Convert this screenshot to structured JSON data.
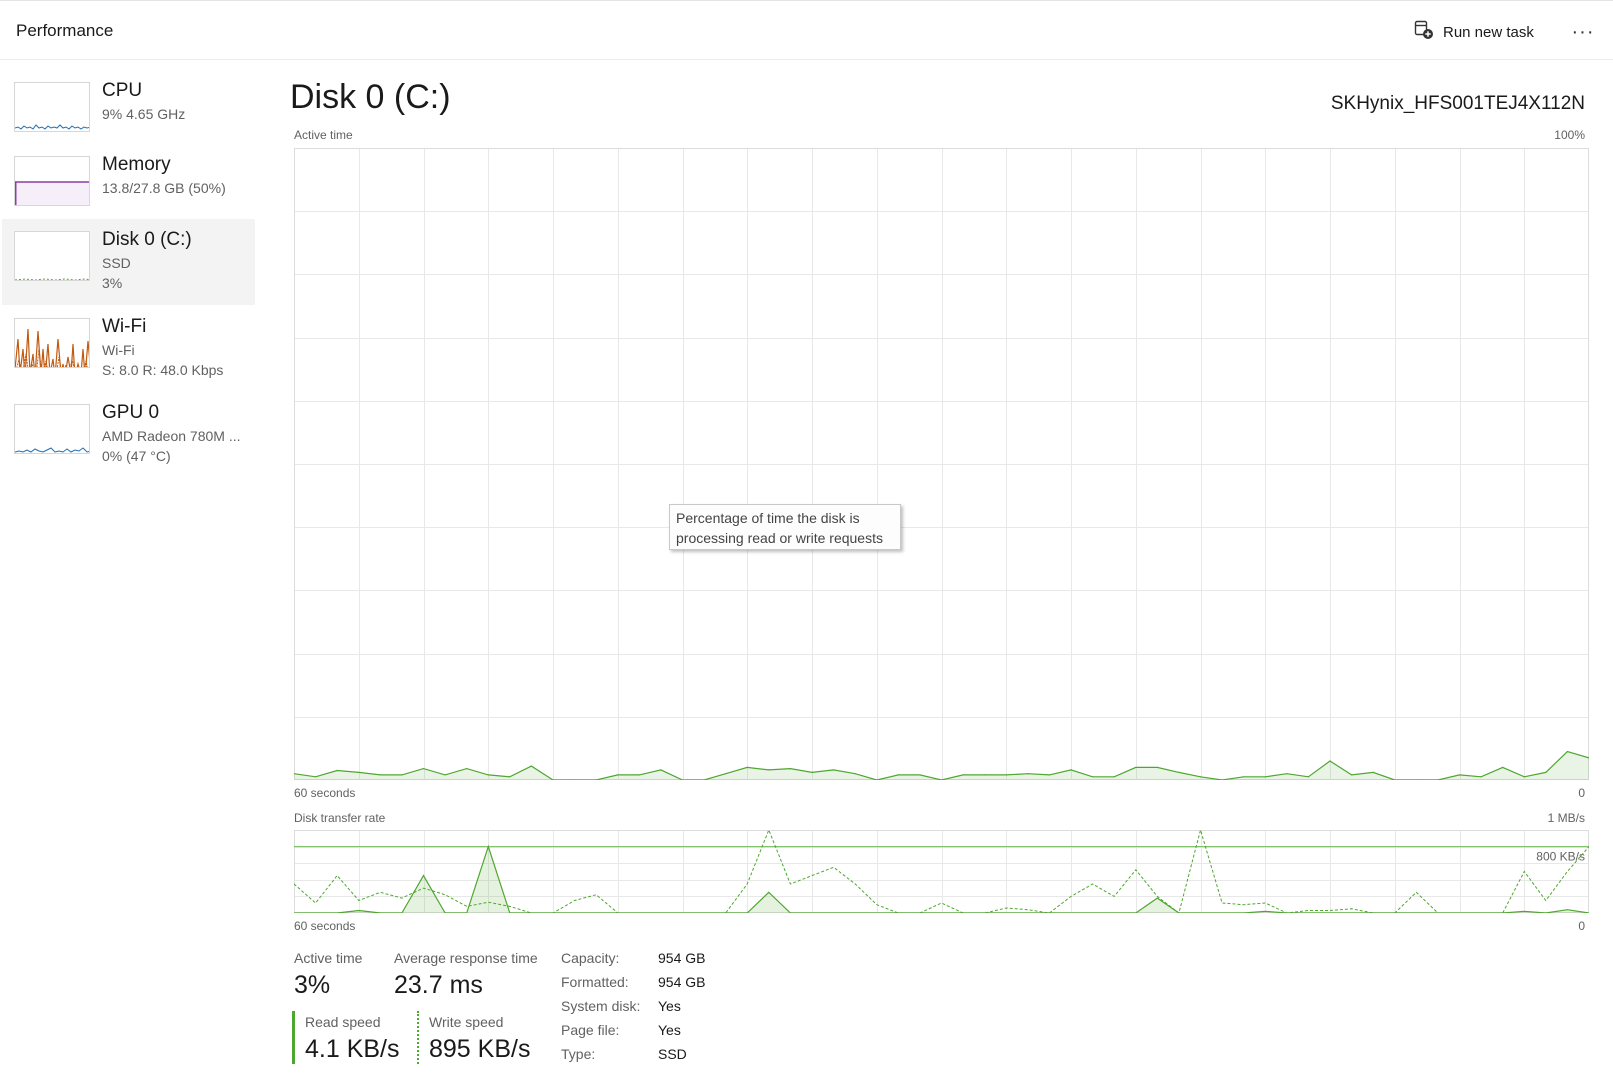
{
  "header": {
    "title": "Performance",
    "run_new_task": "Run new task",
    "more_glyph": "···"
  },
  "sidebar": {
    "items": [
      {
        "name": "CPU",
        "line1": "9%  4.65 GHz",
        "line2": "",
        "color": "#1f6fb5"
      },
      {
        "name": "Memory",
        "line1": "13.8/27.8 GB (50%)",
        "line2": "",
        "color": "#8b3fa8",
        "fill_level": 0.5
      },
      {
        "name": "Disk 0 (C:)",
        "line1": "SSD",
        "line2": "3%",
        "color": "#4ea72e",
        "selected": true
      },
      {
        "name": "Wi-Fi",
        "line1": "Wi-Fi",
        "line2": "S: 8.0  R: 48.0 Kbps",
        "color": "#c05a11"
      },
      {
        "name": "GPU 0",
        "line1": "AMD Radeon 780M ...",
        "line2": "0%  (47 °C)",
        "color": "#1f6fb5"
      }
    ]
  },
  "main": {
    "title": "Disk 0 (C:)",
    "model": "SKHynix_HFS001TEJ4X112N",
    "active_graph": {
      "label": "Active time",
      "max_label": "100%",
      "time_label": "60 seconds",
      "min_label": "0",
      "tooltip_line1": "Percentage of time the disk is",
      "tooltip_line2": "processing read or write requests",
      "color": "#4ea72e"
    },
    "transfer_graph": {
      "label": "Disk transfer rate",
      "max_label": "1 MB/s",
      "ref_label": "800 KB/s",
      "time_label": "60 seconds",
      "min_label": "0",
      "color": "#4ea72e"
    },
    "stats": {
      "active_time_label": "Active time",
      "active_time_value": "3%",
      "avg_response_label": "Average response time",
      "avg_response_value": "23.7 ms",
      "read_speed_label": "Read speed",
      "read_speed_value": "4.1 KB/s",
      "write_speed_label": "Write speed",
      "write_speed_value": "895 KB/s"
    },
    "properties": [
      {
        "key": "Capacity:",
        "value": "954 GB"
      },
      {
        "key": "Formatted:",
        "value": "954 GB"
      },
      {
        "key": "System disk:",
        "value": "Yes"
      },
      {
        "key": "Page file:",
        "value": "Yes"
      },
      {
        "key": "Type:",
        "value": "SSD"
      }
    ]
  },
  "chart_data": [
    {
      "type": "area",
      "title": "Active time",
      "xlabel": "60 seconds",
      "ylabel": "",
      "xlim": [
        60,
        0
      ],
      "ylim": [
        0,
        100
      ],
      "x": [
        60,
        59,
        58,
        57,
        56,
        55,
        54,
        53,
        52,
        51,
        50,
        49,
        48,
        47,
        46,
        45,
        44,
        43,
        42,
        41,
        40,
        39,
        38,
        37,
        36,
        35,
        34,
        33,
        32,
        31,
        30,
        29,
        28,
        27,
        26,
        25,
        24,
        23,
        22,
        21,
        20,
        19,
        18,
        17,
        16,
        15,
        14,
        13,
        12,
        11,
        10,
        9,
        8,
        7,
        6,
        5,
        4,
        3,
        2,
        1,
        0
      ],
      "series": [
        {
          "values": [
            1,
            0.5,
            1.5,
            1.2,
            0.8,
            0.8,
            1.8,
            0.8,
            1.8,
            0.8,
            0.5,
            2.2,
            0,
            0,
            0,
            0.8,
            0.8,
            1.6,
            0,
            0,
            1,
            2,
            1.6,
            1.8,
            1.2,
            1.6,
            1,
            0,
            0.8,
            0.8,
            0,
            0.8,
            0.8,
            0.8,
            1,
            0.8,
            1.6,
            0.5,
            0.5,
            2,
            2,
            1.2,
            0.5,
            0,
            0.5,
            0.5,
            1,
            0.5,
            3,
            0.8,
            1.2,
            0,
            0,
            0,
            0.8,
            0.5,
            2,
            0.5,
            1.2,
            4.5,
            3.5
          ]
        }
      ]
    },
    {
      "type": "line",
      "title": "Disk transfer rate",
      "xlabel": "60 seconds",
      "ylabel": "",
      "xlim": [
        60,
        0
      ],
      "ylim": [
        0,
        1000
      ],
      "ref_lines": [
        800
      ],
      "x": [
        60,
        59,
        58,
        57,
        56,
        55,
        54,
        53,
        52,
        51,
        50,
        49,
        48,
        47,
        46,
        45,
        44,
        43,
        42,
        41,
        40,
        39,
        38,
        37,
        36,
        35,
        34,
        33,
        32,
        31,
        30,
        29,
        28,
        27,
        26,
        25,
        24,
        23,
        22,
        21,
        20,
        19,
        18,
        17,
        16,
        15,
        14,
        13,
        12,
        11,
        10,
        9,
        8,
        7,
        6,
        5,
        4,
        3,
        2,
        1,
        0
      ],
      "series": [
        {
          "name": "Read speed",
          "values": [
            0,
            0,
            0,
            30,
            0,
            0,
            450,
            0,
            0,
            800,
            0,
            0,
            0,
            0,
            0,
            0,
            0,
            0,
            0,
            0,
            0,
            0,
            250,
            0,
            0,
            0,
            0,
            0,
            0,
            0,
            0,
            0,
            0,
            0,
            0,
            0,
            0,
            0,
            0,
            0,
            180,
            0,
            0,
            0,
            0,
            20,
            0,
            0,
            0,
            0,
            0,
            0,
            0,
            0,
            0,
            0,
            0,
            20,
            0,
            40,
            0
          ]
        },
        {
          "name": "Write speed",
          "values": [
            350,
            120,
            450,
            150,
            250,
            180,
            300,
            220,
            80,
            130,
            80,
            0,
            0,
            150,
            220,
            0,
            0,
            0,
            0,
            0,
            0,
            350,
            1100,
            350,
            450,
            550,
            350,
            100,
            0,
            0,
            120,
            0,
            0,
            60,
            40,
            0,
            200,
            350,
            200,
            520,
            200,
            0,
            1300,
            120,
            100,
            120,
            0,
            30,
            30,
            50,
            0,
            0,
            250,
            0,
            0,
            0,
            0,
            500,
            150,
            500,
            800
          ]
        }
      ]
    }
  ]
}
